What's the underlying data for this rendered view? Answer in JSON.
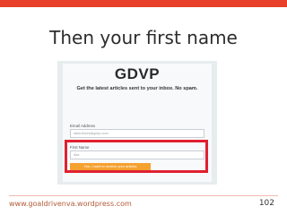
{
  "slide": {
    "title": "Then your first name",
    "footer_url": "www.goaldrivenva.wordpress.com",
    "page_number": "102",
    "accent_color": "#e8402a"
  },
  "form": {
    "logo": "GDVP",
    "tagline": "Get the latest articles sent to your inbox. No spam.",
    "email_label": "Email Address",
    "email_value": "dalia.flores@gdvp.com",
    "first_name_label": "First Name",
    "first_name_value": "Alia",
    "submit_label": "Yes, I want to receive your articles",
    "highlight_color": "#e0202f",
    "button_color": "#f5a12f"
  }
}
